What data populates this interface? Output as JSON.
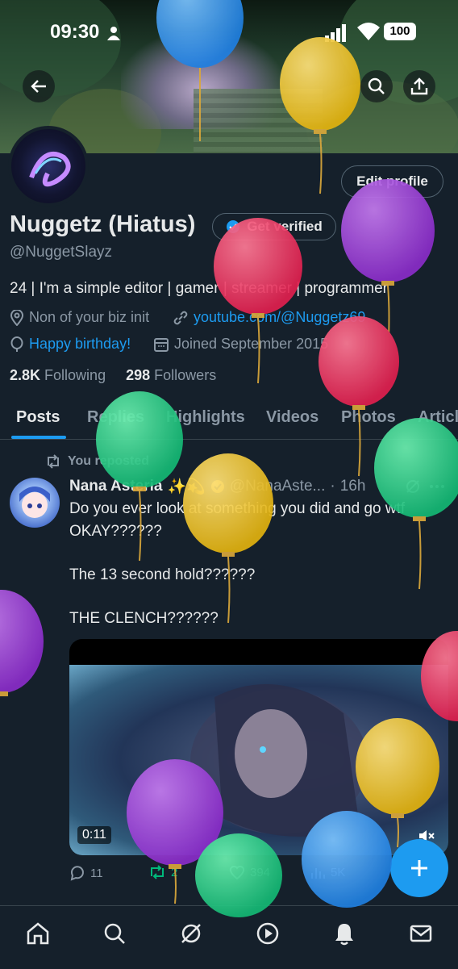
{
  "status_bar": {
    "time": "09:30",
    "battery": "100"
  },
  "profile": {
    "name": "Nuggetz (Hiatus)",
    "handle": "@NuggetSlayz",
    "edit_label": "Edit profile",
    "verify_label": "Get verified",
    "bio": "24 | I'm a simple editor | gamer | streamer | programmer",
    "location": "Non of your biz init",
    "website": "youtube.com/@Nuggetz69",
    "birthday": "Happy birthday!",
    "joined": "Joined September 2015",
    "following_count": "2.8K",
    "following_label": "Following",
    "followers_count": "298",
    "followers_label": "Followers"
  },
  "tabs": [
    {
      "label": "Posts"
    },
    {
      "label": "Replies"
    },
    {
      "label": "Highlights"
    },
    {
      "label": "Videos"
    },
    {
      "label": "Photos"
    },
    {
      "label": "Articles"
    }
  ],
  "post": {
    "repost_label": "You reposted",
    "author_name": "Nana Asteria",
    "author_emoji": "✨💫",
    "author_handle": "@NanaAste...",
    "time": "16h",
    "lines": [
      "Do you ever look at something you did and go wtf",
      "OKAY??????",
      "The 13 second hold??????",
      "THE CLENCH??????"
    ],
    "video_duration": "0:11",
    "replies": "11",
    "reposts": "2",
    "likes": "394",
    "views": "5K"
  },
  "colors": {
    "accent": "#1d9bf0",
    "background": "#15202b",
    "repost_green": "#00ba7c"
  },
  "icons": [
    "back-icon",
    "search-icon",
    "share-icon",
    "location-icon",
    "link-icon",
    "balloon-icon",
    "calendar-icon",
    "repost-icon",
    "verified-icon",
    "more-icon",
    "reply-icon",
    "like-icon",
    "views-icon",
    "mute-icon",
    "plus-icon",
    "home-icon",
    "grok-icon",
    "play-icon",
    "bell-icon",
    "mail-icon"
  ]
}
